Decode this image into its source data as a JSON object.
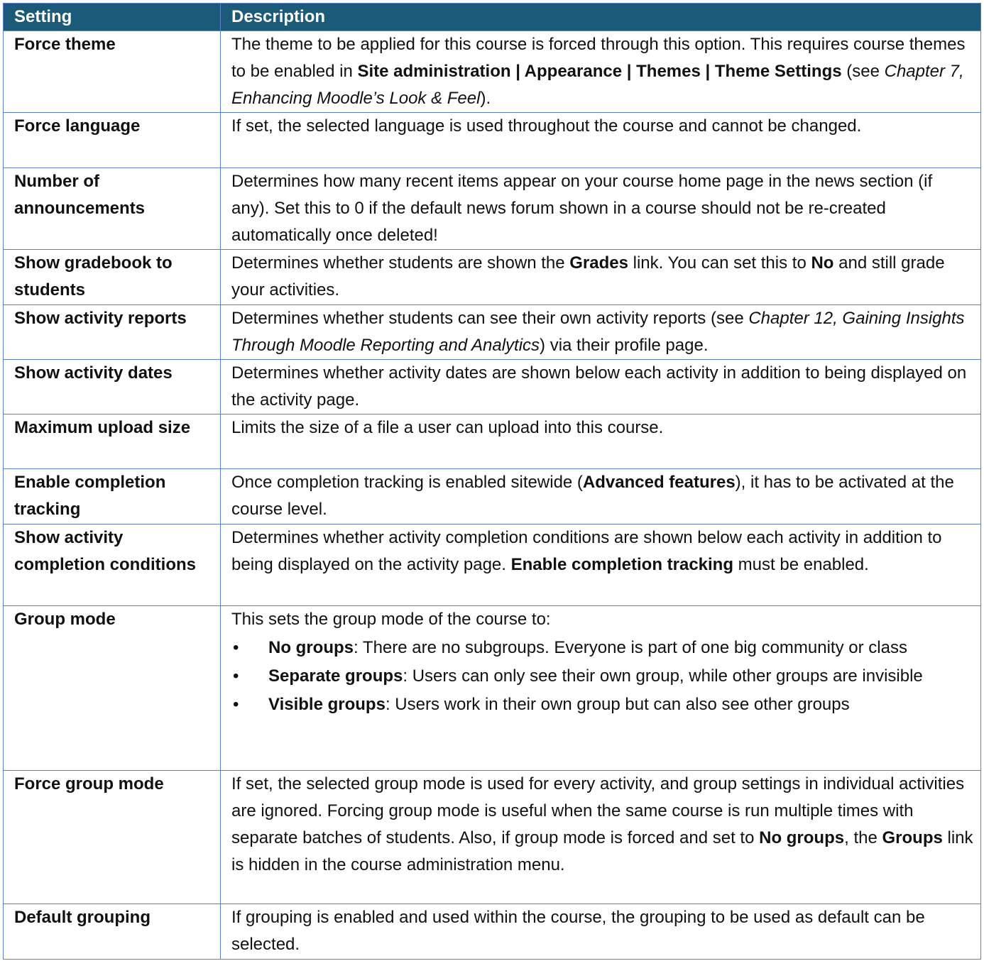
{
  "table": {
    "header": {
      "setting": "Setting",
      "description": "Description"
    },
    "colors": {
      "header_bg": "#1b5a78",
      "header_text": "#ffffff",
      "border": "#5b82c8"
    },
    "rows": [
      {
        "setting": "Force theme",
        "desc": {
          "t1": "The theme to be applied for this course is forced through this option. This requires course themes to be enabled in ",
          "b1": "Site administration | Appearance | Themes | Theme Settings",
          "t2": " (see ",
          "i1": "Chapter 7, Enhancing Moodle’s Look & Feel",
          "t3": ")."
        }
      },
      {
        "setting": "Force language",
        "desc": {
          "t1": "If set, the selected language is used throughout the course and cannot be changed."
        }
      },
      {
        "setting": "Number of announcements",
        "desc": {
          "t1": "Determines how many recent items appear on your course home page in the news section (if any). Set this to 0 if the default news forum shown in a course should not be re-created automatically once deleted!"
        }
      },
      {
        "setting": "Show gradebook to students",
        "desc": {
          "t1": "Determines whether students are shown the ",
          "b1": "Grades",
          "t2": " link. You can set this to ",
          "b2": "No",
          "t3": " and still grade your activities."
        }
      },
      {
        "setting": "Show activity reports",
        "desc": {
          "t1": "Determines whether students can see their own activity reports (see ",
          "i1": "Chapter 12, Gaining Insights Through Moodle Reporting and Analytics",
          "t2": ") via their profile page."
        }
      },
      {
        "setting": "Show activity dates",
        "desc": {
          "t1": "Determines whether activity dates are shown below each activity in addition to being displayed on the activity page."
        }
      },
      {
        "setting": "Maximum upload size",
        "desc": {
          "t1": "Limits the size of a file a user can upload into this course."
        }
      },
      {
        "setting": "Enable completion tracking",
        "desc": {
          "t1": "Once completion tracking is enabled sitewide (",
          "b1": "Advanced features",
          "t2": "), it has to be activated at the course level."
        }
      },
      {
        "setting": "Show activity completion conditions",
        "desc": {
          "t1": "Determines whether activity completion conditions are shown below each activity in addition to being displayed on the activity page. ",
          "b1": "Enable completion tracking",
          "t2": " must be enabled."
        }
      },
      {
        "setting": "Group mode",
        "desc": {
          "t1": "This sets the group mode of the course to:",
          "options": [
            {
              "bullet": "•",
              "name": "No groups",
              "text": ": There are no subgroups. Everyone is part of one big community or class"
            },
            {
              "bullet": "•",
              "name": "Separate groups",
              "text": ": Users can only see their own group, while other groups are invisible"
            },
            {
              "bullet": "•",
              "name": "Visible groups",
              "text": ": Users work in their own group but can also see other groups"
            }
          ]
        }
      },
      {
        "setting": "Force group mode",
        "desc": {
          "t1": "If set, the selected group mode is used for every activity, and group settings in individual activities are ignored. Forcing group mode is useful when the same course is run multiple times with separate batches of students. Also, if group mode is forced and set to ",
          "b1": "No groups",
          "t2": ", the ",
          "b2": "Groups",
          "t3": " link is hidden in the course administration menu."
        }
      },
      {
        "setting": "Default grouping",
        "desc": {
          "t1": "If grouping is enabled and used within the course, the grouping to be used as default can be selected."
        }
      }
    ]
  }
}
